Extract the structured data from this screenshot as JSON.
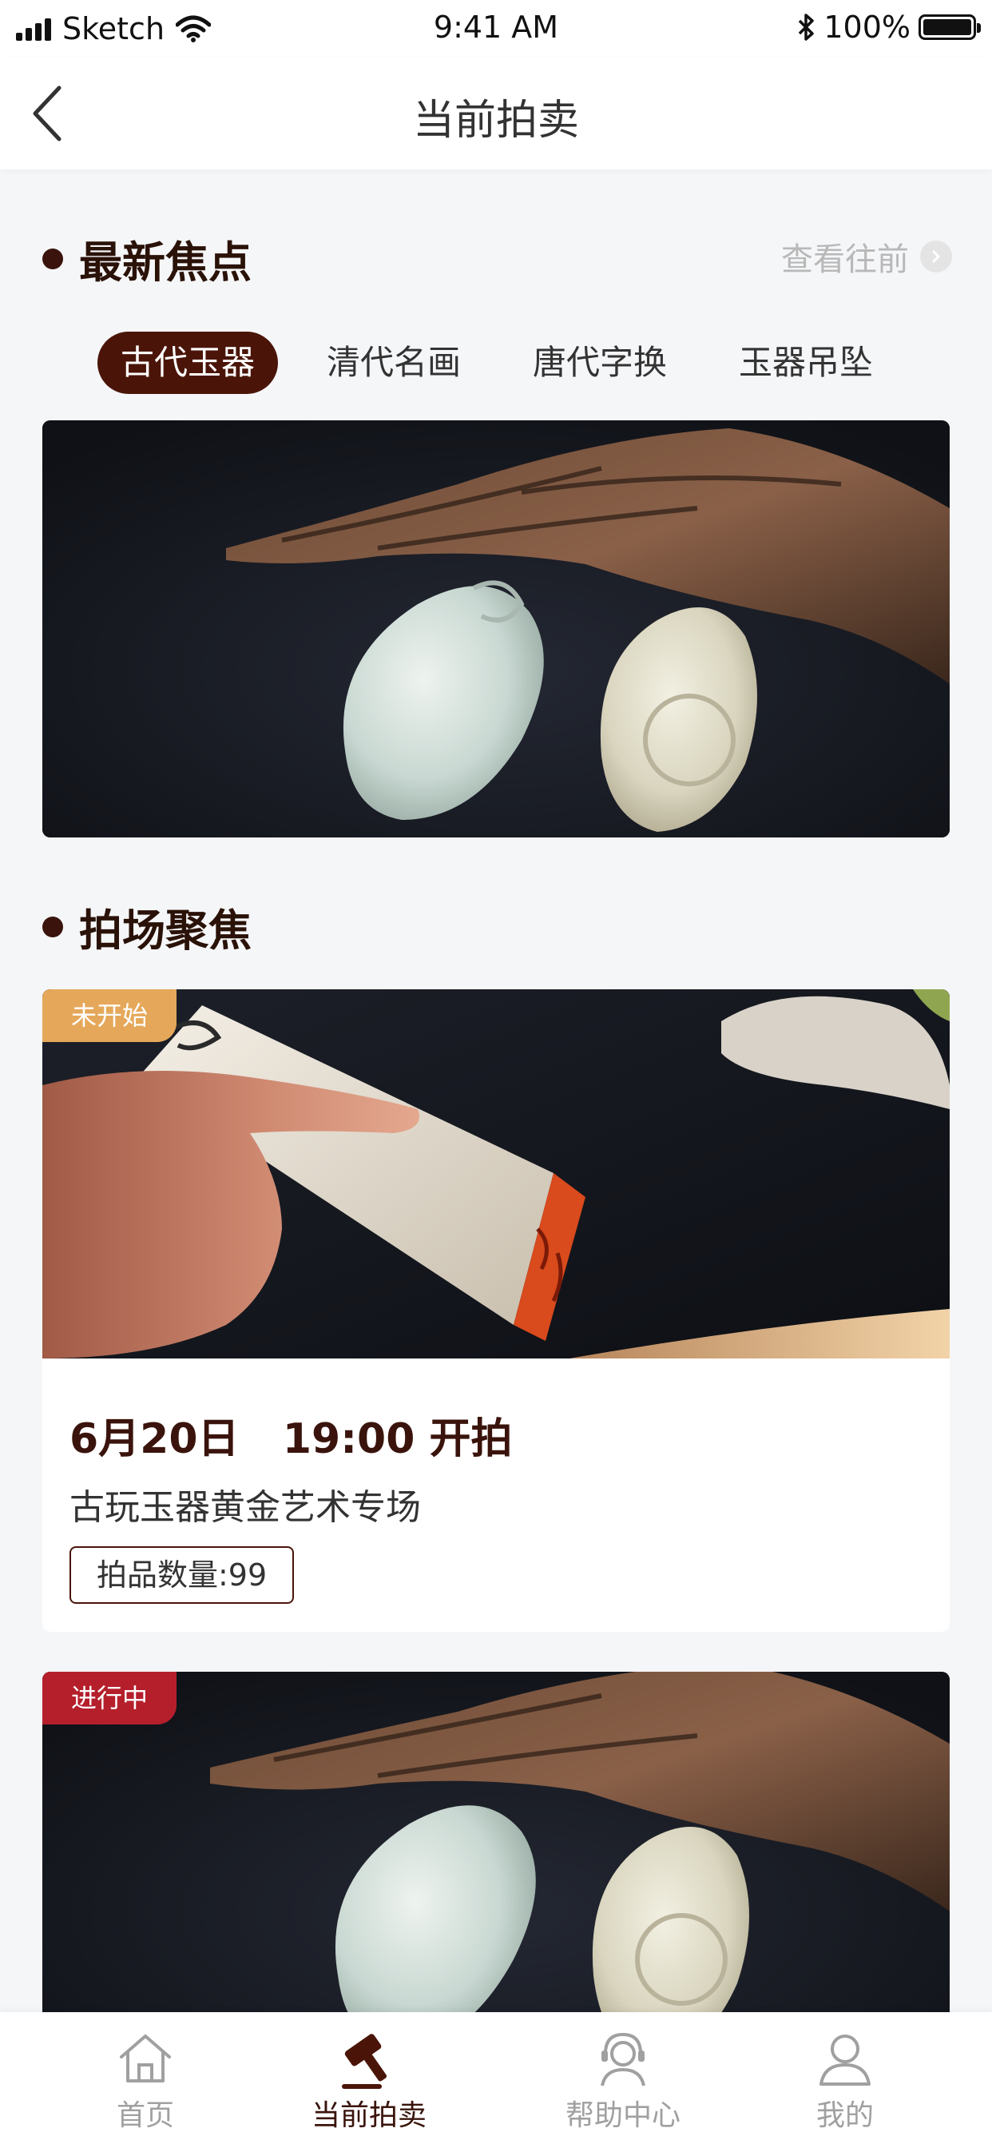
{
  "status_bar": {
    "carrier": "Sketch",
    "time": "9:41 AM",
    "battery": "100%"
  },
  "nav": {
    "title": "当前拍卖"
  },
  "focus": {
    "title": "最新焦点",
    "view_past": "查看往前",
    "tabs": [
      {
        "label": "古代玉器",
        "active": true
      },
      {
        "label": "清代名画",
        "active": false
      },
      {
        "label": "唐代字换",
        "active": false
      },
      {
        "label": "玉器吊坠",
        "active": false
      }
    ]
  },
  "auction_focus": {
    "title": "拍场聚焦",
    "cards": [
      {
        "status": "未开始",
        "status_color": "#e5a85a",
        "date": "6月20日   19:00 开拍",
        "name": "古玩玉器黄金艺术专场",
        "count": "拍品数量:99"
      },
      {
        "status": "进行中",
        "status_color": "#b51f2c"
      }
    ]
  },
  "tabbar": {
    "items": [
      {
        "label": "首页",
        "icon": "home-icon",
        "active": false
      },
      {
        "label": "当前拍卖",
        "icon": "gavel-icon",
        "active": true
      },
      {
        "label": "帮助中心",
        "icon": "headset-icon",
        "active": false
      },
      {
        "label": "我的",
        "icon": "user-icon",
        "active": false
      }
    ]
  },
  "colors": {
    "primary": "#4a1508",
    "accent_pending": "#e5a85a",
    "accent_live": "#b51f2c",
    "background": "#f5f6f8"
  }
}
